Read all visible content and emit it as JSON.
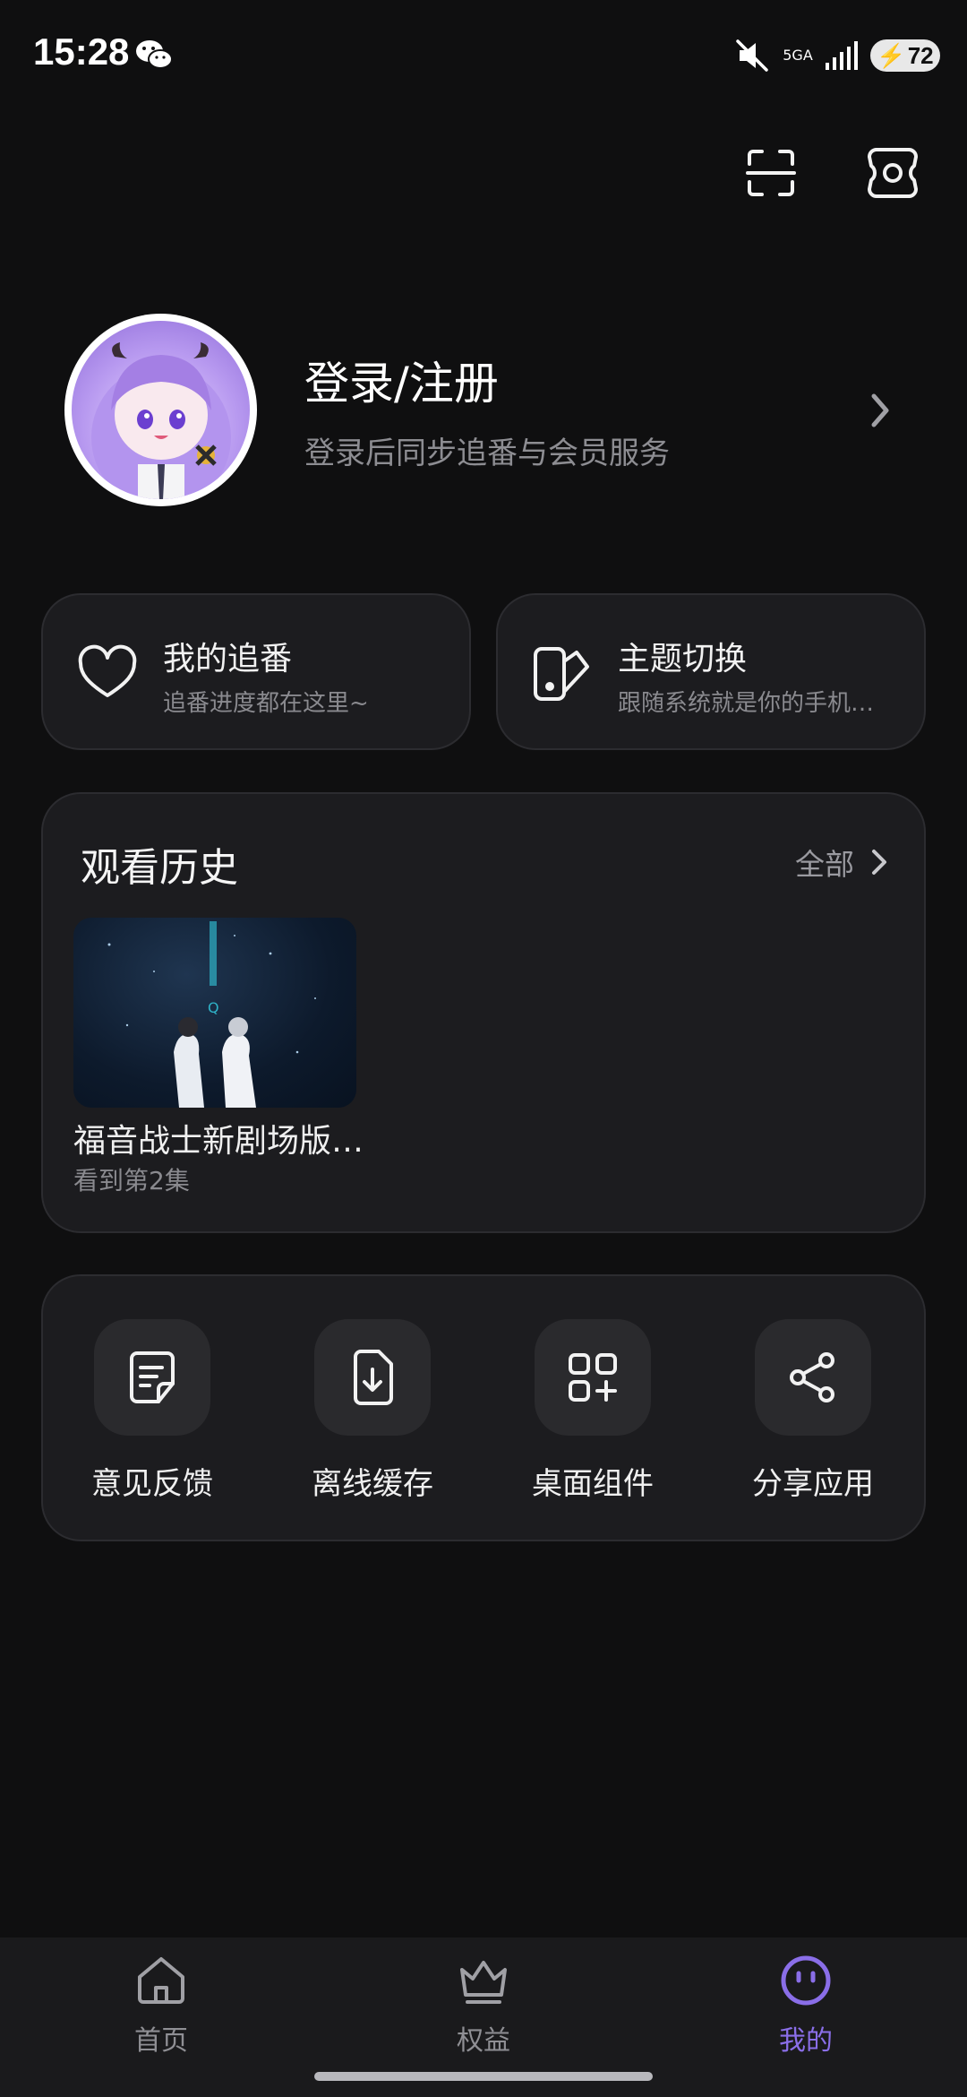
{
  "status_bar": {
    "time": "15:28",
    "network": "5GA",
    "battery": "72",
    "icons": [
      "wechat-icon",
      "mute-icon",
      "signal-icon",
      "battery-icon"
    ]
  },
  "header": {
    "icons": [
      "scan-icon",
      "settings-icon"
    ]
  },
  "profile": {
    "title": "登录/注册",
    "subtitle": "登录后同步追番与会员服务",
    "avatar_icon": "avatar"
  },
  "quick_cards": [
    {
      "title": "我的追番",
      "subtitle": "追番进度都在这里~",
      "icon": "heart-icon"
    },
    {
      "title": "主题切换",
      "subtitle": "跟随系统就是你的手机…",
      "icon": "theme-icon"
    }
  ],
  "history": {
    "title": "观看历史",
    "all_label": "全部",
    "items": [
      {
        "name": "福音战士新剧场版…",
        "progress": "看到第2集"
      }
    ]
  },
  "tools": [
    {
      "label": "意见反馈",
      "icon": "feedback-icon"
    },
    {
      "label": "离线缓存",
      "icon": "download-icon"
    },
    {
      "label": "桌面组件",
      "icon": "widget-icon"
    },
    {
      "label": "分享应用",
      "icon": "share-icon"
    }
  ],
  "bottom_nav": {
    "active": "我的",
    "items": [
      {
        "label": "首页",
        "icon": "home-icon"
      },
      {
        "label": "权益",
        "icon": "crown-icon"
      },
      {
        "label": "我的",
        "icon": "smile-icon"
      }
    ]
  },
  "colors": {
    "background": "#0f0f10",
    "card": "#1c1c1f",
    "accent": "#8a6ee8",
    "muted_text": "#8d8d92"
  }
}
